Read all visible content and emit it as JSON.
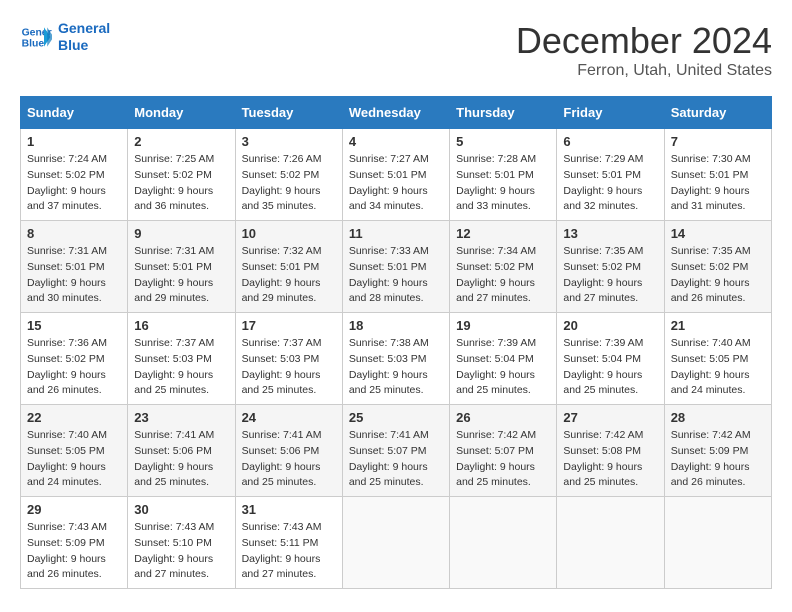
{
  "header": {
    "logo_line1": "General",
    "logo_line2": "Blue",
    "month": "December 2024",
    "location": "Ferron, Utah, United States"
  },
  "days_of_week": [
    "Sunday",
    "Monday",
    "Tuesday",
    "Wednesday",
    "Thursday",
    "Friday",
    "Saturday"
  ],
  "weeks": [
    [
      {
        "num": "1",
        "sunrise": "7:24 AM",
        "sunset": "5:02 PM",
        "daylight": "9 hours and 37 minutes."
      },
      {
        "num": "2",
        "sunrise": "7:25 AM",
        "sunset": "5:02 PM",
        "daylight": "9 hours and 36 minutes."
      },
      {
        "num": "3",
        "sunrise": "7:26 AM",
        "sunset": "5:02 PM",
        "daylight": "9 hours and 35 minutes."
      },
      {
        "num": "4",
        "sunrise": "7:27 AM",
        "sunset": "5:01 PM",
        "daylight": "9 hours and 34 minutes."
      },
      {
        "num": "5",
        "sunrise": "7:28 AM",
        "sunset": "5:01 PM",
        "daylight": "9 hours and 33 minutes."
      },
      {
        "num": "6",
        "sunrise": "7:29 AM",
        "sunset": "5:01 PM",
        "daylight": "9 hours and 32 minutes."
      },
      {
        "num": "7",
        "sunrise": "7:30 AM",
        "sunset": "5:01 PM",
        "daylight": "9 hours and 31 minutes."
      }
    ],
    [
      {
        "num": "8",
        "sunrise": "7:31 AM",
        "sunset": "5:01 PM",
        "daylight": "9 hours and 30 minutes."
      },
      {
        "num": "9",
        "sunrise": "7:31 AM",
        "sunset": "5:01 PM",
        "daylight": "9 hours and 29 minutes."
      },
      {
        "num": "10",
        "sunrise": "7:32 AM",
        "sunset": "5:01 PM",
        "daylight": "9 hours and 29 minutes."
      },
      {
        "num": "11",
        "sunrise": "7:33 AM",
        "sunset": "5:01 PM",
        "daylight": "9 hours and 28 minutes."
      },
      {
        "num": "12",
        "sunrise": "7:34 AM",
        "sunset": "5:02 PM",
        "daylight": "9 hours and 27 minutes."
      },
      {
        "num": "13",
        "sunrise": "7:35 AM",
        "sunset": "5:02 PM",
        "daylight": "9 hours and 27 minutes."
      },
      {
        "num": "14",
        "sunrise": "7:35 AM",
        "sunset": "5:02 PM",
        "daylight": "9 hours and 26 minutes."
      }
    ],
    [
      {
        "num": "15",
        "sunrise": "7:36 AM",
        "sunset": "5:02 PM",
        "daylight": "9 hours and 26 minutes."
      },
      {
        "num": "16",
        "sunrise": "7:37 AM",
        "sunset": "5:03 PM",
        "daylight": "9 hours and 25 minutes."
      },
      {
        "num": "17",
        "sunrise": "7:37 AM",
        "sunset": "5:03 PM",
        "daylight": "9 hours and 25 minutes."
      },
      {
        "num": "18",
        "sunrise": "7:38 AM",
        "sunset": "5:03 PM",
        "daylight": "9 hours and 25 minutes."
      },
      {
        "num": "19",
        "sunrise": "7:39 AM",
        "sunset": "5:04 PM",
        "daylight": "9 hours and 25 minutes."
      },
      {
        "num": "20",
        "sunrise": "7:39 AM",
        "sunset": "5:04 PM",
        "daylight": "9 hours and 25 minutes."
      },
      {
        "num": "21",
        "sunrise": "7:40 AM",
        "sunset": "5:05 PM",
        "daylight": "9 hours and 24 minutes."
      }
    ],
    [
      {
        "num": "22",
        "sunrise": "7:40 AM",
        "sunset": "5:05 PM",
        "daylight": "9 hours and 24 minutes."
      },
      {
        "num": "23",
        "sunrise": "7:41 AM",
        "sunset": "5:06 PM",
        "daylight": "9 hours and 25 minutes."
      },
      {
        "num": "24",
        "sunrise": "7:41 AM",
        "sunset": "5:06 PM",
        "daylight": "9 hours and 25 minutes."
      },
      {
        "num": "25",
        "sunrise": "7:41 AM",
        "sunset": "5:07 PM",
        "daylight": "9 hours and 25 minutes."
      },
      {
        "num": "26",
        "sunrise": "7:42 AM",
        "sunset": "5:07 PM",
        "daylight": "9 hours and 25 minutes."
      },
      {
        "num": "27",
        "sunrise": "7:42 AM",
        "sunset": "5:08 PM",
        "daylight": "9 hours and 25 minutes."
      },
      {
        "num": "28",
        "sunrise": "7:42 AM",
        "sunset": "5:09 PM",
        "daylight": "9 hours and 26 minutes."
      }
    ],
    [
      {
        "num": "29",
        "sunrise": "7:43 AM",
        "sunset": "5:09 PM",
        "daylight": "9 hours and 26 minutes."
      },
      {
        "num": "30",
        "sunrise": "7:43 AM",
        "sunset": "5:10 PM",
        "daylight": "9 hours and 27 minutes."
      },
      {
        "num": "31",
        "sunrise": "7:43 AM",
        "sunset": "5:11 PM",
        "daylight": "9 hours and 27 minutes."
      },
      null,
      null,
      null,
      null
    ]
  ],
  "labels": {
    "sunrise": "Sunrise:",
    "sunset": "Sunset:",
    "daylight": "Daylight:"
  }
}
